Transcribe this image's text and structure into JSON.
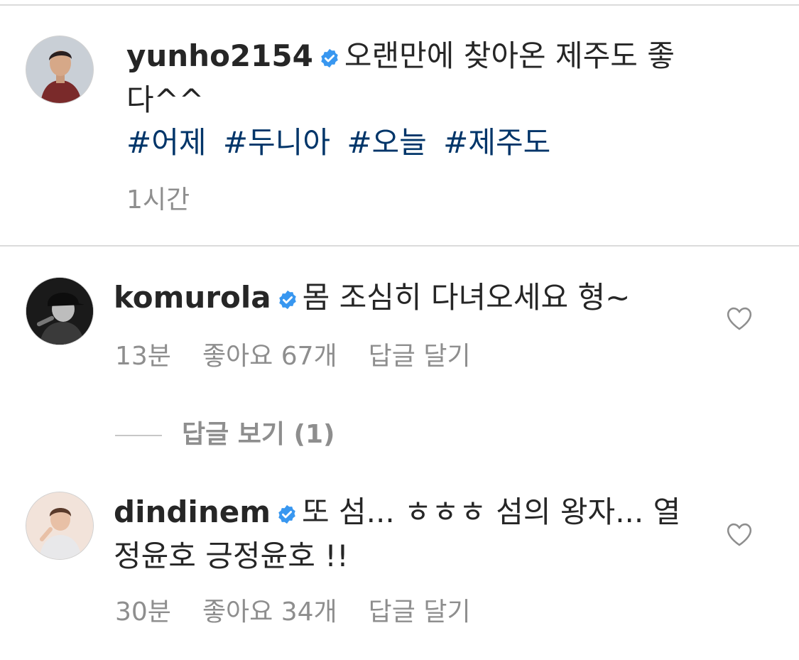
{
  "post": {
    "username": "yunho2154",
    "caption": "오랜만에 찾아온 제주도 좋다^^",
    "hashtags": [
      "#어제",
      "#두니아",
      "#오늘",
      "#제주도"
    ],
    "time": "1시간",
    "verified": true
  },
  "comments": [
    {
      "username": "komurola",
      "verified": true,
      "text": "몸 조심히 다녀오세요 형~",
      "time": "13분",
      "likes": "좋아요 67개",
      "reply_label": "답글 달기",
      "liked": false
    },
    {
      "username": "dindinem",
      "verified": true,
      "text": "또 섬... ㅎㅎㅎ 섬의 왕자... 열정윤호 긍정윤호 !!",
      "time": "30분",
      "likes": "좋아요 34개",
      "reply_label": "답글 달기",
      "liked": false
    }
  ],
  "view_replies": "답글 보기 (1)",
  "colors": {
    "text": "#262626",
    "meta": "#8e8e8e",
    "hashtag": "#003569",
    "verified": "#3897f0",
    "divider": "#dbdbdb"
  },
  "icons": {
    "verified": "verified-badge-icon",
    "like": "heart-outline-icon"
  }
}
